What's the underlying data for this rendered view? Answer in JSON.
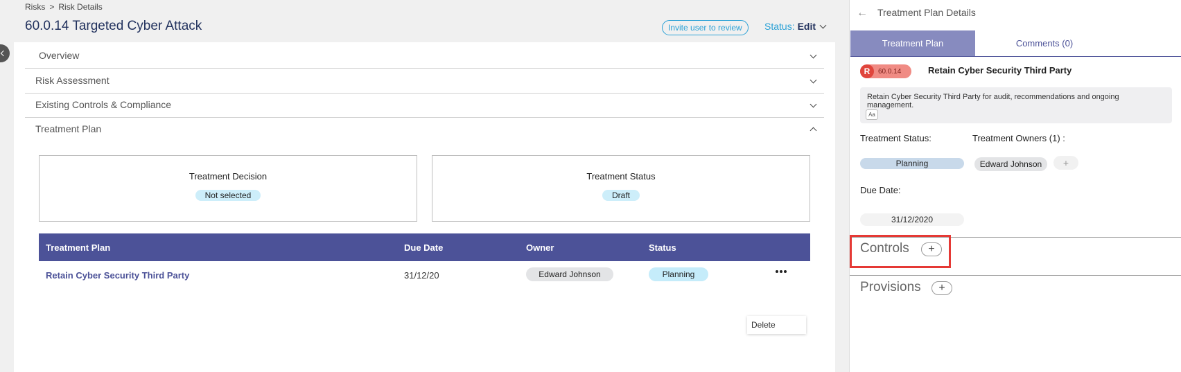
{
  "breadcrumb": {
    "root": "Risks",
    "separator": ">",
    "current": "Risk Details"
  },
  "page": {
    "title": "60.0.14 Targeted Cyber Attack",
    "invite_label": "Invite user to review",
    "status_label": "Status:",
    "status_value": "Edit"
  },
  "sections": [
    {
      "label": "Overview",
      "expanded": false
    },
    {
      "label": "Risk Assessment",
      "expanded": false
    },
    {
      "label": "Existing Controls & Compliance",
      "expanded": false
    },
    {
      "label": "Treatment Plan",
      "expanded": true
    }
  ],
  "treatment_decision": {
    "title": "Treatment Decision",
    "value": "Not selected"
  },
  "treatment_status": {
    "title": "Treatment Status",
    "value": "Draft"
  },
  "table": {
    "headers": [
      "Treatment Plan",
      "Due Date",
      "Owner",
      "Status"
    ],
    "rows": [
      {
        "plan": "Retain Cyber Security Third Party",
        "due": "31/12/20",
        "owner": "Edward Johnson",
        "status": "Planning"
      }
    ],
    "menu_item": "Delete"
  },
  "panel": {
    "title": "Treatment Plan Details",
    "tabs": [
      "Treatment Plan",
      "Comments (0)"
    ],
    "risk_letter": "R",
    "risk_code": "60.0.14",
    "plan_name": "Retain Cyber Security Third Party",
    "description": "Retain Cyber Security Third Party for audit, recommendations and ongoing management.",
    "format_label": "Aa",
    "status_label": "Treatment Status:",
    "owners_label": "Treatment Owners (1) :",
    "status_value": "Planning",
    "owner": "Edward Johnson",
    "owner_add": "+",
    "due_label": "Due Date:",
    "due_value": "31/12/2020",
    "controls_label": "Controls",
    "provisions_label": "Provisions",
    "add_symbol": "+"
  },
  "icons": [
    "back-arrow-icon",
    "chevron-down-icon",
    "chevron-up-icon",
    "more-icon",
    "collapse-icon"
  ],
  "colors": {
    "accent": "#2aa1d6",
    "table_header": "#4c5298",
    "tab_active": "#878bbf",
    "highlight": "#e53935",
    "risk": "#e0453c"
  }
}
